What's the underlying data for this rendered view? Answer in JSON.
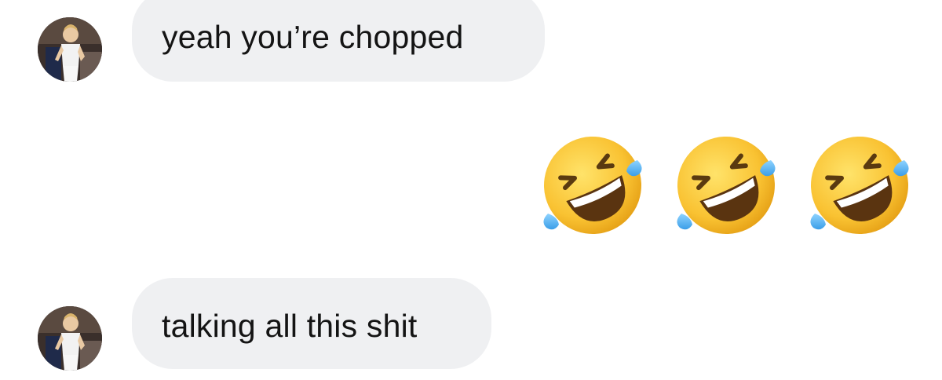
{
  "messages": [
    {
      "sender": "other",
      "text": "yeah you’re chopped"
    },
    {
      "sender": "me",
      "emojis": [
        "rolling-on-the-floor-laughing",
        "rolling-on-the-floor-laughing",
        "rolling-on-the-floor-laughing"
      ]
    },
    {
      "sender": "other",
      "text": "talking all this shit"
    }
  ],
  "colors": {
    "incoming_bubble": "#eff0f2",
    "text": "#141414",
    "background": "#ffffff"
  }
}
